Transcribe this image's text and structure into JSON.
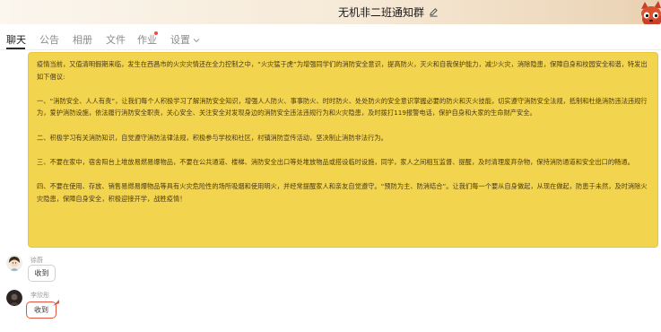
{
  "window": {
    "title": "无机非二班通知群",
    "edit_icon": "pencil-icon",
    "mascot_icon": "cartoon-fox-icon"
  },
  "tabs": [
    {
      "label": "聊天",
      "active": true
    },
    {
      "label": "公告",
      "active": false
    },
    {
      "label": "相册",
      "active": false
    },
    {
      "label": "文件",
      "active": false
    },
    {
      "label": "作业",
      "active": false,
      "has_dot": true
    },
    {
      "label": "设置",
      "active": false,
      "has_caret": true
    }
  ],
  "notice": {
    "paragraphs": [
      "疫情当前，又值清明假期来临，发生在西昌市的火灾灾情还在全力控制之中，“火灾猛于虎”为增强同学们的消防安全意识，提高防火，灭火和自我保护能力，减少火灾，消除隐患，保障自身和校园安全和谐，特发出如下倡议:",
      "一、“消防安全、人人有责”，让我们每个人积极学习了解消防安全知识，增强人人防火、事事防火、时时防火、处处防火的安全意识掌握必要的防火和灭火技能，切实遵守消防安全法规，抵制和杜绝消防违法违规行为，爱护消防设施，依法履行消防安全职责，关心安全、关注安全对发现身边的消防安全违法违规行为和火灾隐患，及时拨打119报警电话，保护自身和大家的生命财产安全。",
      "二、积极学习有关消防知识，自觉遵守消防法律法规，积极参与学校和社区，村镇消防宣传活动，坚决制止消防非法行为。",
      "三、不要在家中，宿舍阳台上堆放易燃易爆物品，不要在公共通道、楼梯、消防安全出口等处堆放物品或搭设临时设施，同学，家人之间相互监督、提醒，及时清理废弃杂物，保持消防通道和安全出口的畅通。",
      "四、不要在使用、存放、销售易燃易爆物品等具有火灾危险性的场所吸烟和使用明火，并经常提醒家人和亲友自觉遵守。“预防为主、防消结合”。让我们每一个要从自身做起，从现在做起，防患于未然，及时消除火灾隐患，保障自身安全，积极迎接开学，战胜疫情！"
    ]
  },
  "messages": [
    {
      "sender": "徐蔚",
      "text": "收到",
      "avatar_icon": "cartoon-girl-avatar-icon",
      "color": "#b9d7ef"
    },
    {
      "sender": "李欣彤",
      "text": "收到",
      "avatar_icon": "dark-portrait-avatar-icon",
      "color": "#e2563f"
    }
  ],
  "colors": {
    "notice_bg": "#f3d44e",
    "active_tab": "#1a1a1a",
    "inactive_tab": "#8b8b8b",
    "dot": "#f04848"
  }
}
